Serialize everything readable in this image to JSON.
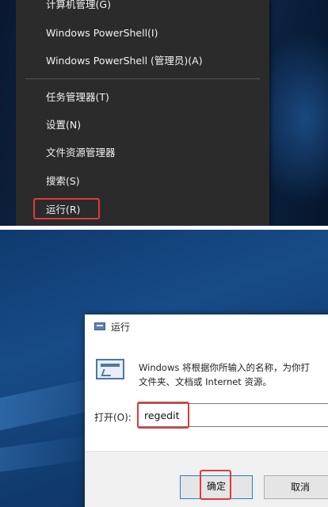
{
  "context_menu": {
    "items": [
      {
        "label": "计算机管理(G)"
      },
      {
        "label": "Windows PowerShell(I)"
      },
      {
        "label": "Windows PowerShell (管理员)(A)"
      },
      {
        "label": "任务管理器(T)"
      },
      {
        "label": "设置(N)"
      },
      {
        "label": "文件资源管理器"
      },
      {
        "label": "搜索(S)"
      },
      {
        "label": "运行(R)"
      }
    ]
  },
  "run_dialog": {
    "title": "运行",
    "description_line1": "Windows 将根据你所输入的名称，为你打",
    "description_line2": "文件夹、文档或 Internet 资源。",
    "open_label": "打开(O):",
    "input_value": "regedit",
    "ok_label": "确定",
    "cancel_label": "取消"
  },
  "colors": {
    "highlight": "#e03a3a",
    "menu_bg": "#2b2b2b",
    "accent_blue": "#2c7ad6"
  }
}
